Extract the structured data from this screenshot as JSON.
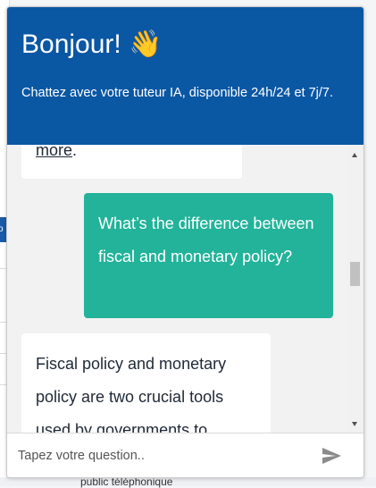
{
  "background": {
    "tab_label": "o",
    "bottom_text": "public téléphonique"
  },
  "chat": {
    "title": "Bonjour! 👋",
    "subtitle": "Chattez avec votre tuteur IA, disponible 24h/24 et 7j/7.",
    "messages": [
      {
        "role": "bot",
        "text_link": "more",
        "text_suffix": "."
      },
      {
        "role": "user",
        "text": "What’s the difference between fiscal and monetary policy?"
      },
      {
        "role": "bot",
        "text": "Fiscal policy and monetary policy are two crucial tools used by governments to"
      }
    ],
    "input": {
      "placeholder": "Tapez votre question..",
      "value": ""
    },
    "send_icon": "send-icon"
  },
  "colors": {
    "header": "#0a57a4",
    "user_bubble": "#22b39a",
    "bot_bubble": "#ffffff",
    "messages_bg": "#f2f2f3"
  }
}
